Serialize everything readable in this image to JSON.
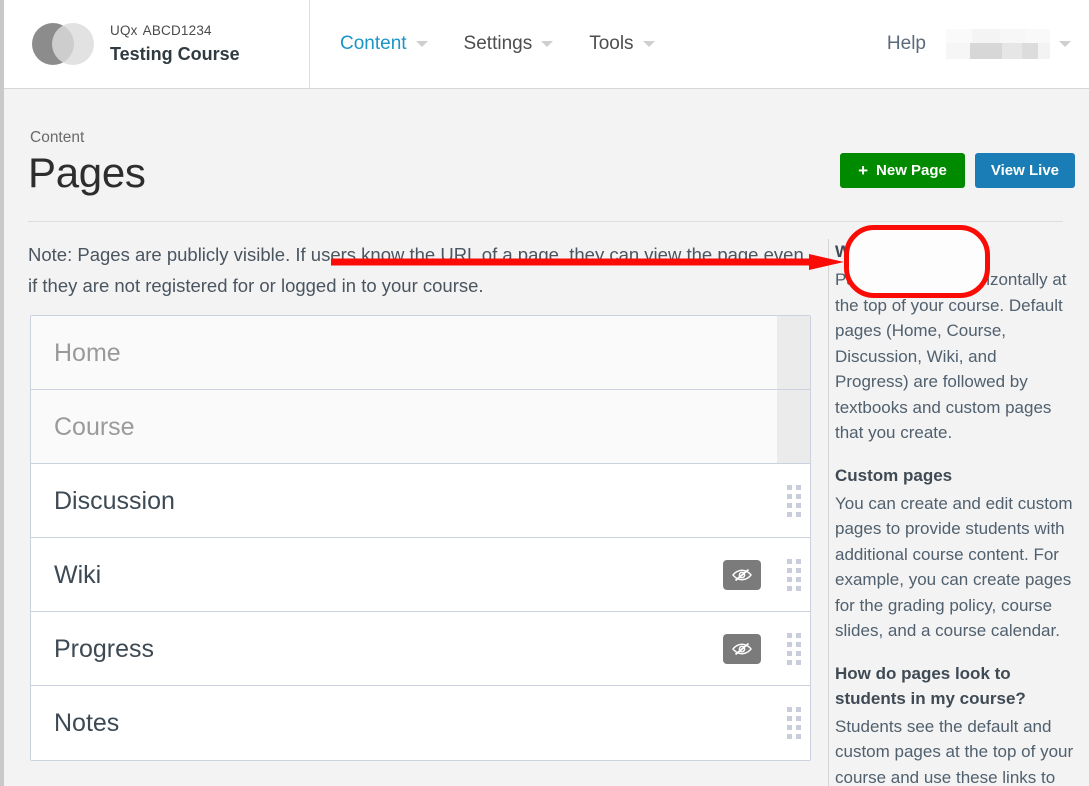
{
  "header": {
    "logo_icon": "two-overlapping-circles-logo",
    "course_code_org": "UQx",
    "course_code_number": "ABCD1234",
    "course_name": "Testing Course",
    "nav": [
      {
        "label": "Content",
        "active": true,
        "caret_icon": "chevron-down-icon"
      },
      {
        "label": "Settings",
        "active": false,
        "caret_icon": "chevron-down-icon"
      },
      {
        "label": "Tools",
        "active": false,
        "caret_icon": "chevron-down-icon"
      }
    ],
    "help_label": "Help",
    "user_name_redacted": "",
    "user_caret_icon": "chevron-down-icon"
  },
  "page": {
    "breadcrumb": "Content",
    "title": "Pages",
    "note": "Note: Pages are publicly visible. If users know the URL of a page, they can view the page even if they are not registered for or logged in to your course."
  },
  "toolbar": {
    "new_page_label": "New Page",
    "new_page_plus_icon": "plus-icon",
    "new_page_color": "#008a00",
    "view_live_label": "View Live",
    "view_live_color": "#1a7db5"
  },
  "annotations": {
    "color": "#fb0b05",
    "arrow_icon": "right-arrow-annotation",
    "highlight_icon": "oval-highlight-annotation",
    "target": "New Page"
  },
  "page_list": [
    {
      "label": "Home",
      "fixed": true,
      "hidden_toggle": false,
      "drag_handle": false
    },
    {
      "label": "Course",
      "fixed": true,
      "hidden_toggle": false,
      "drag_handle": false
    },
    {
      "label": "Discussion",
      "fixed": false,
      "hidden_toggle": false,
      "drag_handle": true
    },
    {
      "label": "Wiki",
      "fixed": false,
      "hidden_toggle": true,
      "drag_handle": true
    },
    {
      "label": "Progress",
      "fixed": false,
      "hidden_toggle": true,
      "drag_handle": true
    },
    {
      "label": "Notes",
      "fixed": false,
      "hidden_toggle": false,
      "drag_handle": true
    }
  ],
  "row_icons": {
    "eye_slash": "eye-slash-icon",
    "drag": "drag-handle-icon"
  },
  "sidebar": [
    {
      "heading": "What are pages?",
      "body": "Pages are listed horizontally at the top of your course. Default pages (Home, Course, Discussion, Wiki, and Progress) are followed by textbooks and custom pages that you create."
    },
    {
      "heading": "Custom pages",
      "body": "You can create and edit custom pages to provide students with additional course content. For example, you can create pages for the grading policy, course slides, and a course calendar."
    },
    {
      "heading": "How do pages look to students in my course?",
      "body": "Students see the default and custom pages at the top of your course and use these links to"
    }
  ]
}
